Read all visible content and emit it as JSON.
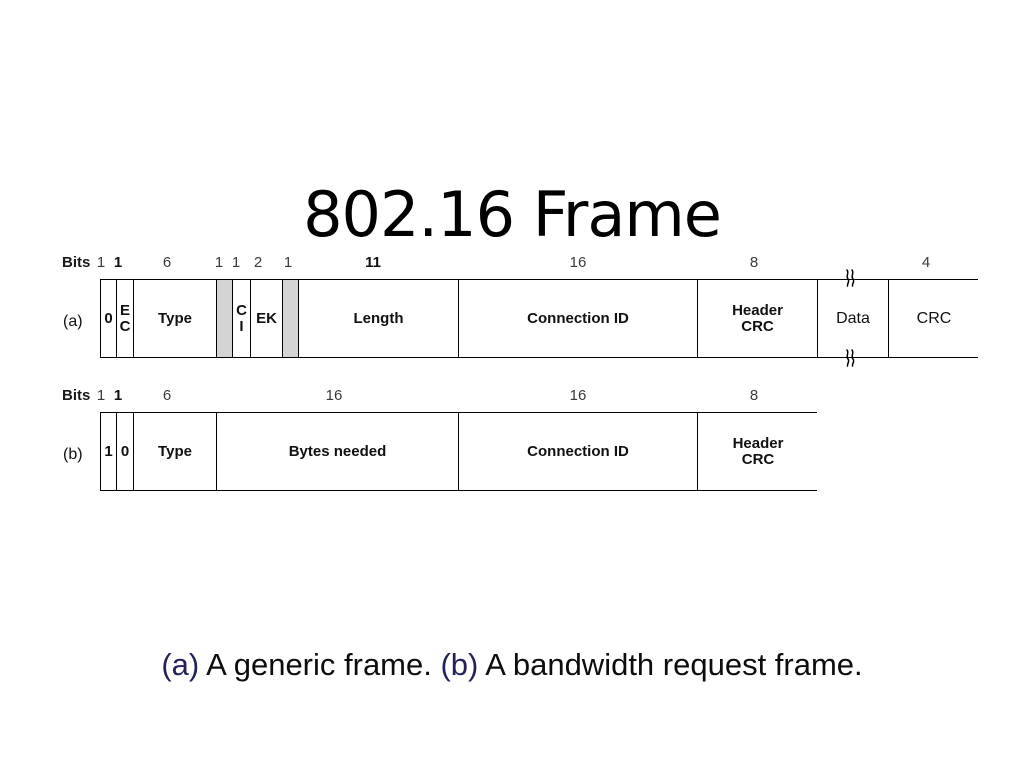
{
  "slide": {
    "title": "802.16 Frame",
    "caption": {
      "label_a": "(a)",
      "text_a": " A generic frame. ",
      "label_b": "(b)",
      "text_b": " A bandwidth request frame.",
      "full": "(a) A generic frame. (b) A bandwidth request frame.",
      "label_color": "#23235c"
    }
  },
  "diagram": {
    "bits_word": "Bits",
    "shaded_color": "#d4d4d4",
    "break_symbol": "squiggle-break",
    "frames": [
      {
        "id": "frame-a",
        "side_label": "(a)",
        "bit_labels": [
          "1",
          "1",
          "6",
          "1",
          "1",
          "2",
          "1",
          "11",
          "16",
          "8",
          "",
          "4"
        ],
        "cells": [
          {
            "label": "0",
            "bits": "1",
            "shaded": false,
            "stacked": false
          },
          {
            "label": "EC",
            "bits": "1",
            "shaded": false,
            "stacked": true
          },
          {
            "label": "Type",
            "bits": "6",
            "shaded": false,
            "stacked": false
          },
          {
            "label": "",
            "bits": "1",
            "shaded": true,
            "stacked": false
          },
          {
            "label": "CI",
            "bits": "1",
            "shaded": false,
            "stacked": true
          },
          {
            "label": "EK",
            "bits": "2",
            "shaded": false,
            "stacked": false
          },
          {
            "label": "",
            "bits": "1",
            "shaded": true,
            "stacked": false
          },
          {
            "label": "Length",
            "bits": "11",
            "shaded": false,
            "stacked": false
          },
          {
            "label": "Connection ID",
            "bits": "16",
            "shaded": false,
            "stacked": false
          },
          {
            "label": "Header CRC",
            "bits": "8",
            "shaded": false,
            "stacked": true
          },
          {
            "label": "Data",
            "bits": "",
            "shaded": false,
            "stacked": false
          },
          {
            "label": "CRC",
            "bits": "4",
            "shaded": false,
            "stacked": false
          }
        ]
      },
      {
        "id": "frame-b",
        "side_label": "(b)",
        "bit_labels": [
          "1",
          "1",
          "6",
          "16",
          "16",
          "8"
        ],
        "cells": [
          {
            "label": "1",
            "bits": "1",
            "shaded": false,
            "stacked": false
          },
          {
            "label": "0",
            "bits": "1",
            "shaded": false,
            "stacked": false
          },
          {
            "label": "Type",
            "bits": "6",
            "shaded": false,
            "stacked": false
          },
          {
            "label": "Bytes needed",
            "bits": "16",
            "shaded": false,
            "stacked": false
          },
          {
            "label": "Connection ID",
            "bits": "16",
            "shaded": false,
            "stacked": false
          },
          {
            "label": "Header CRC",
            "bits": "8",
            "shaded": false,
            "stacked": true
          }
        ]
      }
    ]
  }
}
